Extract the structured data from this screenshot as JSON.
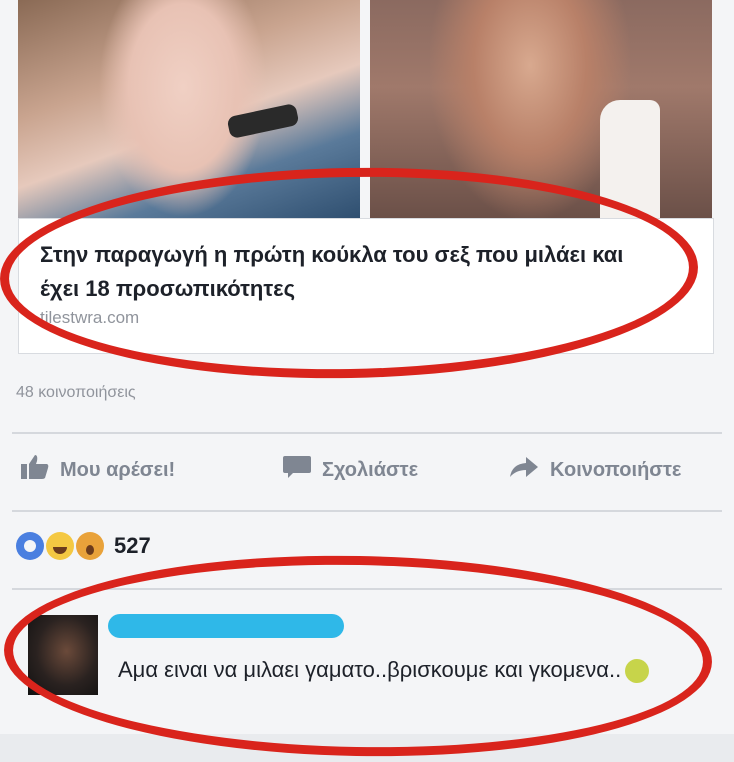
{
  "link": {
    "title": "Στην παραγωγή η πρώτη κούκλα του σεξ που μιλάει και έχει 18 προσωπικότητες",
    "domain": "tilestwra.com"
  },
  "stats": {
    "shares": "48 κοινοποιήσεις",
    "reaction_count": "527"
  },
  "actions": {
    "like": "Μου αρέσει!",
    "comment": "Σχολιάστε",
    "share": "Κοινοποιήστε"
  },
  "comment": {
    "text": "Αμα ειναι να μιλαει γαματο..βρισκουμε και γκομενα.."
  },
  "colors": {
    "highlight_circle": "#d9241c",
    "redaction": "#2fb8e8"
  }
}
